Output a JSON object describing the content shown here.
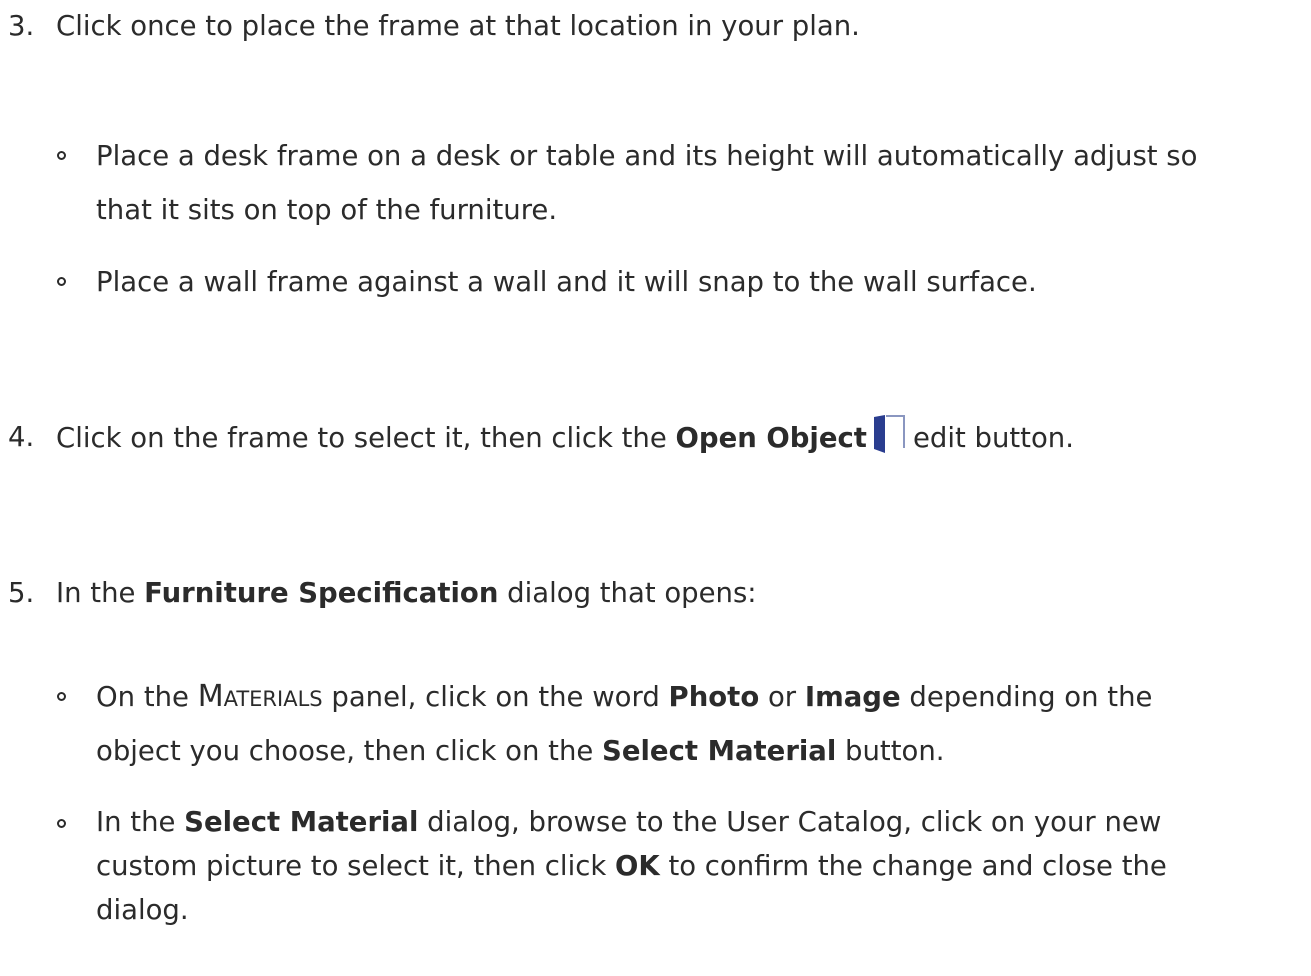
{
  "steps": [
    {
      "number": "3.",
      "text": "Click once to place the frame at that location in your plan.",
      "bullets": [
        {
          "line1": "Place a desk frame on a desk or table and its height will automatically adjust so",
          "line2": "that it sits on top of the furniture."
        },
        {
          "line1": "Place a wall frame against a wall and it will snap to the wall surface."
        }
      ]
    },
    {
      "number": "4.",
      "text_before": "Click on the frame to select it, then click the",
      "bold": "Open Object",
      "icon": "open-object-door-icon",
      "text_after": "edit button."
    },
    {
      "number": "5.",
      "text_before": "In the",
      "bold": "Furniture Specification",
      "text_after": "dialog that opens:",
      "bullets": [
        {
          "l1_a": "On the",
          "l1_sc": "Materials",
          "l1_b": "panel, click on the word",
          "l1_bold1": "Photo",
          "l1_c": "or",
          "l1_bold2": "Image",
          "l1_d": "depending on the",
          "l2_a": "object you choose, then click on the",
          "l2_bold": "Select Material",
          "l2_b": "button."
        },
        {
          "l1_a": "In the",
          "l1_bold": "Select Material",
          "l1_b": "dialog, browse to the User Catalog, click on your new",
          "l2_a": "custom picture to select it, then click",
          "l2_bold": "OK",
          "l2_b": "to confirm the change and close the",
          "l3": "dialog."
        }
      ]
    }
  ],
  "colors": {
    "text": "#2b2b2b",
    "icon_door": "#2a3d8f",
    "icon_frame": "#8a96c0"
  }
}
